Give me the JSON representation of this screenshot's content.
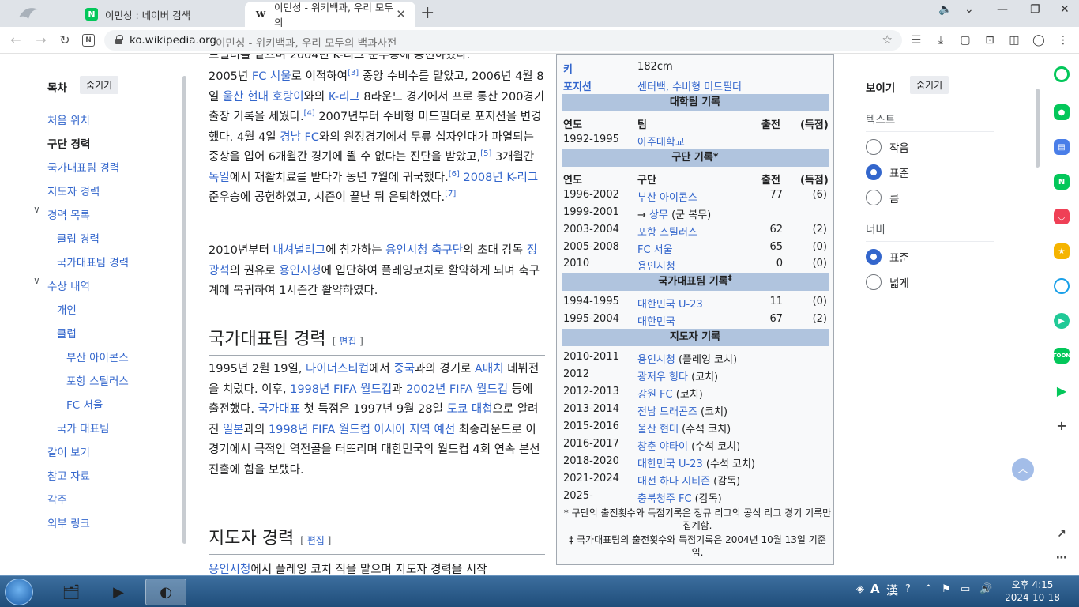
{
  "browser": {
    "tabs": [
      {
        "label": "이민성 : 네이버 검색",
        "favicon": "N",
        "active": false
      },
      {
        "label": "이민성 - 위키백과, 우리 모두의",
        "favicon": "W",
        "active": true
      }
    ],
    "url_domain": "ko.wikipedia.org",
    "url_title": "이민성 - 위키백과, 우리 모두의 백과사전"
  },
  "toc": {
    "title": "목차",
    "hide_label": "숨기기",
    "items": [
      {
        "label": "처음 위치",
        "active": false
      },
      {
        "label": "구단 경력",
        "active": true
      },
      {
        "label": "국가대표팀 경력",
        "active": false
      },
      {
        "label": "지도자 경력",
        "active": false
      },
      {
        "label": "경력 목록",
        "active": false
      },
      {
        "label": "클럽 경력",
        "active": false
      },
      {
        "label": "국가대표팀 경력",
        "active": false
      },
      {
        "label": "수상 내역",
        "active": false
      },
      {
        "label": "개인",
        "active": false
      },
      {
        "label": "클럽",
        "active": false
      },
      {
        "label": "부산 아이콘스",
        "active": false
      },
      {
        "label": "포항 스틸러스",
        "active": false
      },
      {
        "label": "FC 서울",
        "active": false
      },
      {
        "label": "국가 대표팀",
        "active": false
      },
      {
        "label": "같이 보기",
        "active": false
      },
      {
        "label": "참고 자료",
        "active": false
      },
      {
        "label": "각주",
        "active": false
      },
      {
        "label": "외부 링크",
        "active": false
      }
    ]
  },
  "article": {
    "top_line": "드필더를 맡으며 2004년 K-리그 준우승에 공헌하였다.",
    "p1": {
      "t1": "2005년 ",
      "l1": "FC 서울",
      "t2": "로 이적하여",
      "r1": "[3]",
      "t3": " 중앙 수비수를 맡았고, 2006년 4월 8일 ",
      "l2": "울산 현대 호랑이",
      "t4": "와의 ",
      "l3": "K-리그",
      "t5": " 8라운드 경기에서 프로 통산 200경기 출장 기록을 세웠다.",
      "r2": "[4]",
      "t6": " 2007년부터 수비형 미드필더로 포지션을 변경했다. 4월 4일 ",
      "l4": "경남 FC",
      "t7": "와의 원정경기에서 무릎 십자인대가 파열되는 중상을 입어 6개월간 경기에 뛸 수 없다는 진단을 받았고,",
      "r3": "[5]",
      "t8": " 3개월간 ",
      "l5": "독일",
      "t9": "에서 재활치료를 받다가 동년 7월에 귀국했다.",
      "r4": "[6]",
      "t10": " ",
      "l6": "2008년 K-리그",
      "t11": " 준우승에 공헌하였고, 시즌이 끝난 뒤 은퇴하였다.",
      "r5": "[7]"
    },
    "p2": {
      "t1": "2010년부터 ",
      "l1": "내셔널리그",
      "t2": "에 참가하는 ",
      "l2": "용인시청 축구단",
      "t3": "의 초대 감독 ",
      "l3": "정광석",
      "t4": "의 권유로 ",
      "l4": "용인시청",
      "t5": "에 입단하여 플레잉코치로 활약하게 되며 축구계에 복귀하여 1시즌간 활약하였다."
    },
    "h_national": "국가대표팀 경력",
    "h_coach": "지도자 경력",
    "edit_label": "편집",
    "p3": {
      "t1": "1995년 2월 19일, ",
      "l1": "다이너스티컵",
      "t2": "에서 ",
      "l2": "중국",
      "t3": "과의 경기로 ",
      "l3": "A매치",
      "t4": " 데뷔전을 치렀다. 이후, ",
      "l4": "1998년 FIFA 월드컵",
      "t5": "과 ",
      "l5": "2002년 FIFA 월드컵",
      "t6": " 등에 출전했다. ",
      "l6": "국가대표",
      "t7": " 첫 득점은 1997년 9월 28일 ",
      "l7": "도쿄 대첩",
      "t8": "으로 알려진 ",
      "l8": "일본",
      "t9": "과의 ",
      "l9": "1998년 FIFA 월드컵 아시아 지역 예선",
      "t10": " 최종라운드로 이 경기에서 극적인 역전골을 터뜨리며 대한민국의 월드컵 4회 연속 본선 진출에 힘을 보탰다."
    },
    "p4": {
      "l1": "용인시청",
      "t1": "에서 플레잉 코치 직을 맡으며 지도자 경력을 시작"
    }
  },
  "infobox": {
    "height_label": "키",
    "height_value": "182cm",
    "position_label": "포지션",
    "position_value": "센터백, 수비형 미드필더",
    "college_header": "대학팀 기록",
    "col_year": "연도",
    "col_team": "팀",
    "col_club": "구단",
    "col_apps": "출전",
    "col_goals": "(득점)",
    "college_rows": [
      {
        "year": "1992-1995",
        "team": "아주대학교",
        "apps": "",
        "goals": ""
      }
    ],
    "club_header": "구단 기록*",
    "club_rows": [
      {
        "year": "1996-2002",
        "team": "부산 아이콘스",
        "note": "",
        "apps": "77",
        "goals": "(6)"
      },
      {
        "year": "1999-2001",
        "team": "상무",
        "prefix": "→ ",
        "note": " (군 복무)",
        "apps": "",
        "goals": ""
      },
      {
        "year": "2003-2004",
        "team": "포항 스틸러스",
        "note": "",
        "apps": "62",
        "goals": "(2)"
      },
      {
        "year": "2005-2008",
        "team": "FC 서울",
        "note": "",
        "apps": "65",
        "goals": "(0)"
      },
      {
        "year": "2010",
        "team": "용인시청",
        "note": "",
        "apps": "0",
        "goals": "(0)"
      }
    ],
    "national_header": "국가대표팀 기록",
    "national_mark": "‡",
    "national_rows": [
      {
        "year": "1994-1995",
        "team": "대한민국 U-23",
        "apps": "11",
        "goals": "(0)"
      },
      {
        "year": "1995-2004",
        "team": "대한민국",
        "apps": "67",
        "goals": "(2)"
      }
    ],
    "coach_header": "지도자 기록",
    "coach_rows": [
      {
        "year": "2010-2011",
        "team": "용인시청",
        "note": " (플레잉 코치)"
      },
      {
        "year": "2012",
        "team": "광저우 헝다",
        "note": " (코치)"
      },
      {
        "year": "2012-2013",
        "team": "강원 FC",
        "note": " (코치)"
      },
      {
        "year": "2013-2014",
        "team": "전남 드래곤즈",
        "note": " (코치)"
      },
      {
        "year": "2015-2016",
        "team": "울산 현대",
        "note": " (수석 코치)"
      },
      {
        "year": "2016-2017",
        "team": "창춘 야타이",
        "note": " (수석 코치)"
      },
      {
        "year": "2018-2020",
        "team": "대한민국 U-23",
        "note": " (수석 코치)"
      },
      {
        "year": "2021-2024",
        "team": "대전 하나 시티즌",
        "note": " (감독)"
      },
      {
        "year": "2025-",
        "team": "충북청주 FC",
        "note": " (감독)"
      }
    ],
    "note1": "* 구단의 출전횟수와 득점기록은 정규 리그의 공식 리그 경기 기록만 집계함.",
    "note2": "‡ 국가대표팀의 출전횟수와 득점기록은 2004년 10월 13일 기준임."
  },
  "appearance": {
    "title": "보이기",
    "hide_label": "숨기기",
    "text_label": "텍스트",
    "text_options": [
      {
        "label": "작음",
        "on": false
      },
      {
        "label": "표준",
        "on": true
      },
      {
        "label": "큼",
        "on": false
      }
    ],
    "width_label": "너비",
    "width_options": [
      {
        "label": "표준",
        "on": true
      },
      {
        "label": "넓게",
        "on": false
      }
    ]
  },
  "taskbar": {
    "time": "오후 4:15",
    "date": "2024-10-18",
    "ime": "A",
    "hanja": "漢"
  }
}
